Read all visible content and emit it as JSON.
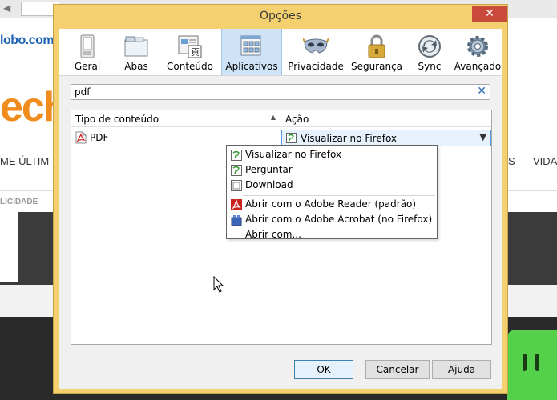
{
  "background": {
    "logo_text": "lobo.com",
    "tech_text": "ech",
    "menu_left": "ME   ÚLTIM",
    "menu_right": "S",
    "menu_right2": "VIDA",
    "ad_label": "LICIDADE"
  },
  "dialog": {
    "title": "Opções",
    "close_glyph": "✕"
  },
  "toolbar": {
    "items": [
      {
        "label": "Geral",
        "icon": "switch-icon"
      },
      {
        "label": "Abas",
        "icon": "tabs-icon"
      },
      {
        "label": "Conteúdo",
        "icon": "content-icon"
      },
      {
        "label": "Aplicativos",
        "icon": "applications-icon",
        "selected": true
      },
      {
        "label": "Privacidade",
        "icon": "mask-icon"
      },
      {
        "label": "Segurança",
        "icon": "lock-icon"
      },
      {
        "label": "Sync",
        "icon": "sync-icon"
      },
      {
        "label": "Avançado",
        "icon": "gear-icon"
      }
    ]
  },
  "search": {
    "value": "pdf",
    "clear_glyph": "✕"
  },
  "table": {
    "headers": [
      "Tipo de conteúdo",
      "Ação"
    ],
    "rows": [
      {
        "type": "PDF",
        "action": "Visualizar no Firefox"
      }
    ]
  },
  "dropdown": {
    "options": [
      {
        "label": "Visualizar no Firefox",
        "icon": "firefox-preview-icon"
      },
      {
        "label": "Perguntar",
        "icon": "ask-icon"
      },
      {
        "label": "Download",
        "icon": "download-icon"
      },
      {
        "label": "Abrir com o Adobe Reader  (padrão)",
        "icon": "adobe-reader-icon"
      },
      {
        "label": "Abrir com o Adobe Acrobat (no Firefox)",
        "icon": "adobe-acrobat-icon"
      },
      {
        "label": "Abrir com...",
        "icon": ""
      }
    ]
  },
  "buttons": {
    "ok": "OK",
    "cancel": "Cancelar",
    "help": "Ajuda"
  },
  "colors": {
    "dialog_frame": "#f4d16e",
    "selected_tab": "#cfe3f7",
    "close_button": "#c94a3a"
  }
}
